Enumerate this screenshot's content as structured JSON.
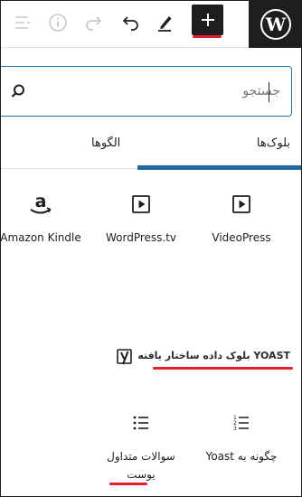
{
  "toolbar": {
    "icons": [
      "list-view-icon",
      "info-icon",
      "redo-icon",
      "undo-icon",
      "pen-icon",
      "plus-icon",
      "wordpress-logo"
    ],
    "accent": "#1e1e1e",
    "highlight_color": "#e0202a"
  },
  "search": {
    "value": "",
    "placeholder": "جستجو"
  },
  "tabs": {
    "blocks_label": "بلوک‌ها",
    "patterns_label": "الگوها",
    "active": "blocks",
    "active_color": "#1e6aa0"
  },
  "embeds": {
    "items": [
      {
        "label": "Amazon Kindle",
        "icon": "amazon-icon"
      },
      {
        "label": "WordPress.tv",
        "icon": "embed-video-icon"
      },
      {
        "label": "VideoPress",
        "icon": "embed-video-icon"
      }
    ]
  },
  "yoast_section": {
    "title": "YOAST بلوک داده ساختار یافته",
    "icon": "yoast-icon",
    "items": [
      {
        "label": "سوالات متداول یوست",
        "icon": "list-unordered-icon"
      },
      {
        "label": "چگونه به Yoast",
        "icon": "list-ordered-icon"
      }
    ]
  }
}
